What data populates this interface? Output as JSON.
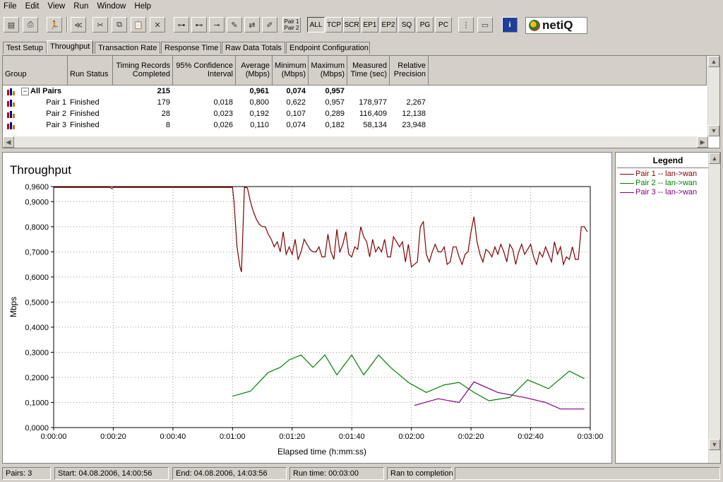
{
  "menu": [
    "File",
    "Edit",
    "View",
    "Run",
    "Window",
    "Help"
  ],
  "toolbar": {
    "pair_button": [
      "Pair 1",
      "Pair 2"
    ],
    "filters": [
      "ALL",
      "TCP",
      "SCR",
      "EP1",
      "EP2",
      "SQ",
      "PG",
      "PC"
    ],
    "logo_text": "netiQ"
  },
  "tabs": [
    "Test Setup",
    "Throughput",
    "Transaction Rate",
    "Response Time",
    "Raw Data Totals",
    "Endpoint Configuration"
  ],
  "active_tab": "Throughput",
  "grid": {
    "headers": [
      "Group",
      "Run Status",
      "Timing Records Completed",
      "95% Confidence Interval",
      "Average (Mbps)",
      "Minimum (Mbps)",
      "Maximum (Mbps)",
      "Measured Time (sec)",
      "Relative Precision"
    ],
    "rows": [
      {
        "group": "All Pairs",
        "status": "",
        "records": "215",
        "ci": "",
        "avg": "0,961",
        "min": "0,074",
        "max": "0,957",
        "time": "",
        "precision": ""
      },
      {
        "group": "Pair 1",
        "status": "Finished",
        "records": "179",
        "ci": "0,018",
        "avg": "0,800",
        "min": "0,622",
        "max": "0,957",
        "time": "178,977",
        "precision": "2,267"
      },
      {
        "group": "Pair 2",
        "status": "Finished",
        "records": "28",
        "ci": "0,023",
        "avg": "0,192",
        "min": "0,107",
        "max": "0,289",
        "time": "116,409",
        "precision": "12,138"
      },
      {
        "group": "Pair 3",
        "status": "Finished",
        "records": "8",
        "ci": "0,026",
        "avg": "0,110",
        "min": "0,074",
        "max": "0,182",
        "time": "58,134",
        "precision": "23,948"
      }
    ]
  },
  "legend": {
    "title": "Legend",
    "entries": [
      {
        "label": "Pair 1 -- lan->wan",
        "color": "#800000"
      },
      {
        "label": "Pair 2 -- lan->wan",
        "color": "#008000"
      },
      {
        "label": "Pair 3 -- lan->wan",
        "color": "#800080"
      }
    ]
  },
  "chart_data": {
    "type": "line",
    "title": "Throughput",
    "xlabel": "Elapsed time (h:mm:ss)",
    "ylabel": "Mbps",
    "xlim": [
      0,
      180
    ],
    "ylim": [
      0,
      0.96
    ],
    "x_ticks": [
      "0:00:00",
      "0:00:20",
      "0:00:40",
      "0:01:00",
      "0:01:20",
      "0:01:40",
      "0:02:00",
      "0:02:20",
      "0:02:40",
      "0:03:00"
    ],
    "y_ticks": [
      "0,0000",
      "0,1000",
      "0,2000",
      "0,3000",
      "0,4000",
      "0,5000",
      "0,6000",
      "0,7000",
      "0,8000",
      "0,9000",
      "0,9600"
    ],
    "grid": true,
    "series": [
      {
        "name": "Pair 1 -- lan->wan",
        "color": "#800000",
        "x": [
          0,
          19,
          19.5,
          20,
          60,
          60.5,
          61.5,
          62.5,
          63,
          64,
          65,
          66,
          67,
          68,
          69,
          70,
          71,
          72,
          73,
          74,
          75,
          76,
          77,
          78,
          79,
          80,
          81,
          82,
          83,
          84,
          85,
          86,
          87,
          88,
          89,
          90,
          91,
          92,
          93,
          94,
          95,
          96,
          97,
          98,
          99,
          100,
          101,
          102,
          103,
          104,
          105,
          106,
          107,
          108,
          109,
          110,
          111,
          112,
          113,
          114,
          115,
          116,
          117,
          118,
          119,
          120,
          121,
          122,
          123,
          124,
          125,
          126,
          127,
          128,
          129,
          130,
          131,
          132,
          133,
          134,
          135,
          136,
          137,
          138,
          139,
          140,
          141,
          142,
          143,
          144,
          145,
          146,
          147,
          148,
          149,
          150,
          151,
          152,
          153,
          154,
          155,
          156,
          157,
          158,
          159,
          160,
          161,
          162,
          163,
          164,
          165,
          166,
          167,
          168,
          169,
          170,
          171,
          172,
          173,
          174,
          175,
          176,
          177,
          178,
          179
        ],
        "y": [
          0.957,
          0.957,
          0.952,
          0.957,
          0.957,
          0.9,
          0.72,
          0.64,
          0.62,
          0.957,
          0.955,
          0.9,
          0.86,
          0.83,
          0.81,
          0.8,
          0.8,
          0.77,
          0.75,
          0.72,
          0.74,
          0.7,
          0.78,
          0.69,
          0.72,
          0.69,
          0.75,
          0.67,
          0.7,
          0.75,
          0.73,
          0.71,
          0.7,
          0.7,
          0.72,
          0.68,
          0.68,
          0.77,
          0.7,
          0.67,
          0.79,
          0.7,
          0.73,
          0.78,
          0.69,
          0.68,
          0.72,
          0.71,
          0.8,
          0.76,
          0.74,
          0.68,
          0.75,
          0.7,
          0.72,
          0.7,
          0.75,
          0.68,
          0.68,
          0.76,
          0.74,
          0.72,
          0.74,
          0.66,
          0.73,
          0.64,
          0.65,
          0.66,
          0.8,
          0.82,
          0.69,
          0.66,
          0.7,
          0.73,
          0.7,
          0.7,
          0.72,
          0.65,
          0.66,
          0.72,
          0.72,
          0.68,
          0.65,
          0.69,
          0.7,
          0.78,
          0.84,
          0.74,
          0.69,
          0.66,
          0.71,
          0.7,
          0.68,
          0.72,
          0.69,
          0.73,
          0.7,
          0.66,
          0.73,
          0.71,
          0.65,
          0.7,
          0.73,
          0.69,
          0.71,
          0.73,
          0.68,
          0.65,
          0.7,
          0.68,
          0.72,
          0.69,
          0.66,
          0.74,
          0.69,
          0.72,
          0.65,
          0.68,
          0.67,
          0.72,
          0.67,
          0.67,
          0.8,
          0.8,
          0.78
        ]
      },
      {
        "name": "Pair 2 -- lan->wan",
        "color": "#008000",
        "x": [
          60,
          66,
          72,
          76,
          79,
          83,
          87,
          91,
          95,
          100,
          104,
          109,
          113,
          119,
          125,
          131,
          136,
          141,
          146,
          153,
          159,
          166,
          173,
          178
        ],
        "y": [
          0.125,
          0.145,
          0.22,
          0.24,
          0.27,
          0.289,
          0.24,
          0.289,
          0.21,
          0.289,
          0.21,
          0.289,
          0.24,
          0.18,
          0.14,
          0.17,
          0.18,
          0.14,
          0.107,
          0.12,
          0.19,
          0.155,
          0.225,
          0.195
        ]
      },
      {
        "name": "Pair 3 -- lan->wan",
        "color": "#800080",
        "x": [
          121,
          129,
          136,
          141,
          149,
          158,
          165,
          170,
          178
        ],
        "y": [
          0.088,
          0.115,
          0.1,
          0.182,
          0.14,
          0.12,
          0.1,
          0.074,
          0.074
        ]
      }
    ]
  },
  "status": {
    "pairs": "Pairs: 3",
    "start": "Start: 04.08.2006, 14:00:56",
    "end": "End: 04.08.2006, 14:03:56",
    "runtime": "Run time: 00:03:00",
    "state": "Ran to completion"
  }
}
